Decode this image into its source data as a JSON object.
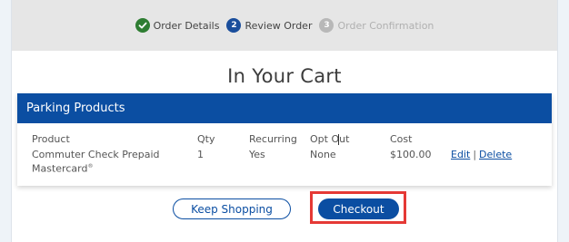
{
  "steps": [
    {
      "label": "Order Details",
      "status": "done",
      "icon": "check-icon"
    },
    {
      "label": "Review Order",
      "status": "active",
      "number": "2"
    },
    {
      "label": "Order Confirmation",
      "status": "pending",
      "number": "3"
    }
  ],
  "page": {
    "title": "In Your Cart"
  },
  "cart": {
    "section_title": "Parking Products",
    "columns": {
      "product": "Product",
      "qty": "Qty",
      "recurring": "Recurring",
      "optout": "Opt Out",
      "cost": "Cost"
    },
    "rows": [
      {
        "product": "Commuter Check Prepaid Mastercard",
        "product_mark": "®",
        "qty": "1",
        "recurring": "Yes",
        "optout": "None",
        "cost": "$100.00",
        "edit_label": "Edit",
        "separator": "|",
        "delete_label": "Delete"
      }
    ]
  },
  "actions": {
    "keep_shopping_label": "Keep Shopping",
    "checkout_label": "Checkout"
  },
  "colors": {
    "brand_blue": "#0b4ea2",
    "success_green": "#2e7d32",
    "highlight_red": "#e53935"
  }
}
